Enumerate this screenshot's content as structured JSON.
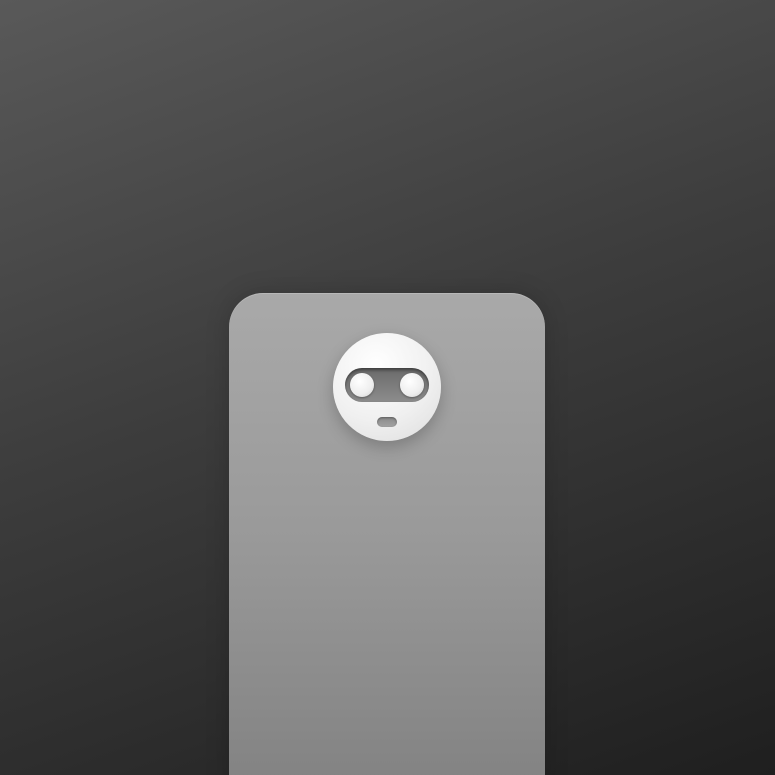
{
  "scene": {
    "subject": "phone-back",
    "colors": {
      "background_top": "#595959",
      "background_bottom": "#1f1f1f",
      "phone_body": "#9a9a9a",
      "camera_module": "#f0f0f0",
      "lens_bar": "#7a7a7a",
      "lens": "#eeeeee",
      "flash": "#999999"
    },
    "icons": [
      "camera-module-icon",
      "lens-icon",
      "flash-icon"
    ]
  }
}
